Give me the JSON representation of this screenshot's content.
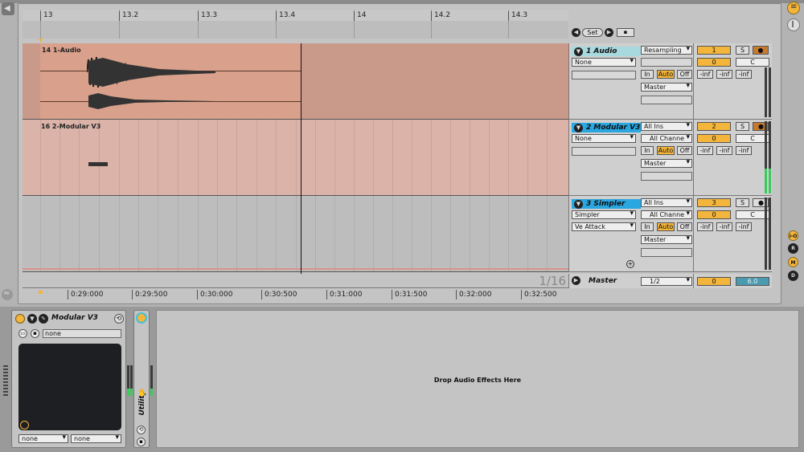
{
  "ruler": {
    "bars": [
      "13",
      "13.2",
      "13.3",
      "13.4",
      "14",
      "14.2",
      "14.3"
    ],
    "set_label": "Set"
  },
  "tracks": [
    {
      "clip_name": "14 1-Audio",
      "title": "1 Audio",
      "input_type": "Resampling",
      "input_channel": "",
      "device_chooser": "None",
      "device_chain": "",
      "monitor": [
        "In",
        "Auto",
        "Off"
      ],
      "output": "Master",
      "number": "1",
      "volume": "0",
      "pan": "C",
      "sends": [
        "-inf",
        "-inf",
        "-inf"
      ],
      "solo": "S",
      "clip_color": "#d9a08b",
      "header_color": "#a8d9df"
    },
    {
      "clip_name": "16 2-Modular V3",
      "title": "2 Modular V3",
      "input_type": "All Ins",
      "input_channel": "All Channe",
      "device_chooser": "None",
      "device_chain": "",
      "monitor": [
        "In",
        "Auto",
        "Off"
      ],
      "output": "Master",
      "number": "2",
      "volume": "0",
      "pan": "C",
      "sends": [
        "-inf",
        "-inf",
        "-inf"
      ],
      "solo": "S",
      "clip_color": "#dfb4a9",
      "header_color": "#2aa6e0"
    },
    {
      "clip_name": "",
      "title": "3 Simpler",
      "input_type": "All Ins",
      "input_channel": "All Channe",
      "device_chooser": "Simpler",
      "device_chain": "Ve Attack",
      "monitor": [
        "In",
        "Auto",
        "Off"
      ],
      "output": "Master",
      "number": "3",
      "volume": "0",
      "pan": "C",
      "sends": [
        "-inf",
        "-inf",
        "-inf"
      ],
      "solo": "S",
      "clip_color": "#bcbcbc",
      "header_color": "#2aa6e0"
    }
  ],
  "master": {
    "label": "Master",
    "grid": "1/16",
    "cue": "1/2",
    "volume": "0",
    "cue_volume": "6.0"
  },
  "timeline": [
    "0:29:000",
    "0:29:500",
    "0:30:000",
    "0:30:500",
    "0:31:000",
    "0:31:500",
    "0:32:000",
    "0:32:500"
  ],
  "device": {
    "name": "Modular V3",
    "preset": "none",
    "selectors": [
      "none",
      "none"
    ],
    "utility_label": "Utility",
    "drop_hint": "Drop Audio Effects Here"
  },
  "side_buttons": [
    "I-O",
    "R",
    "M",
    "D"
  ],
  "colors": {
    "accent": "#f3b53b",
    "meter": "#3ec95d",
    "panel_dark": "#1e1f22"
  }
}
